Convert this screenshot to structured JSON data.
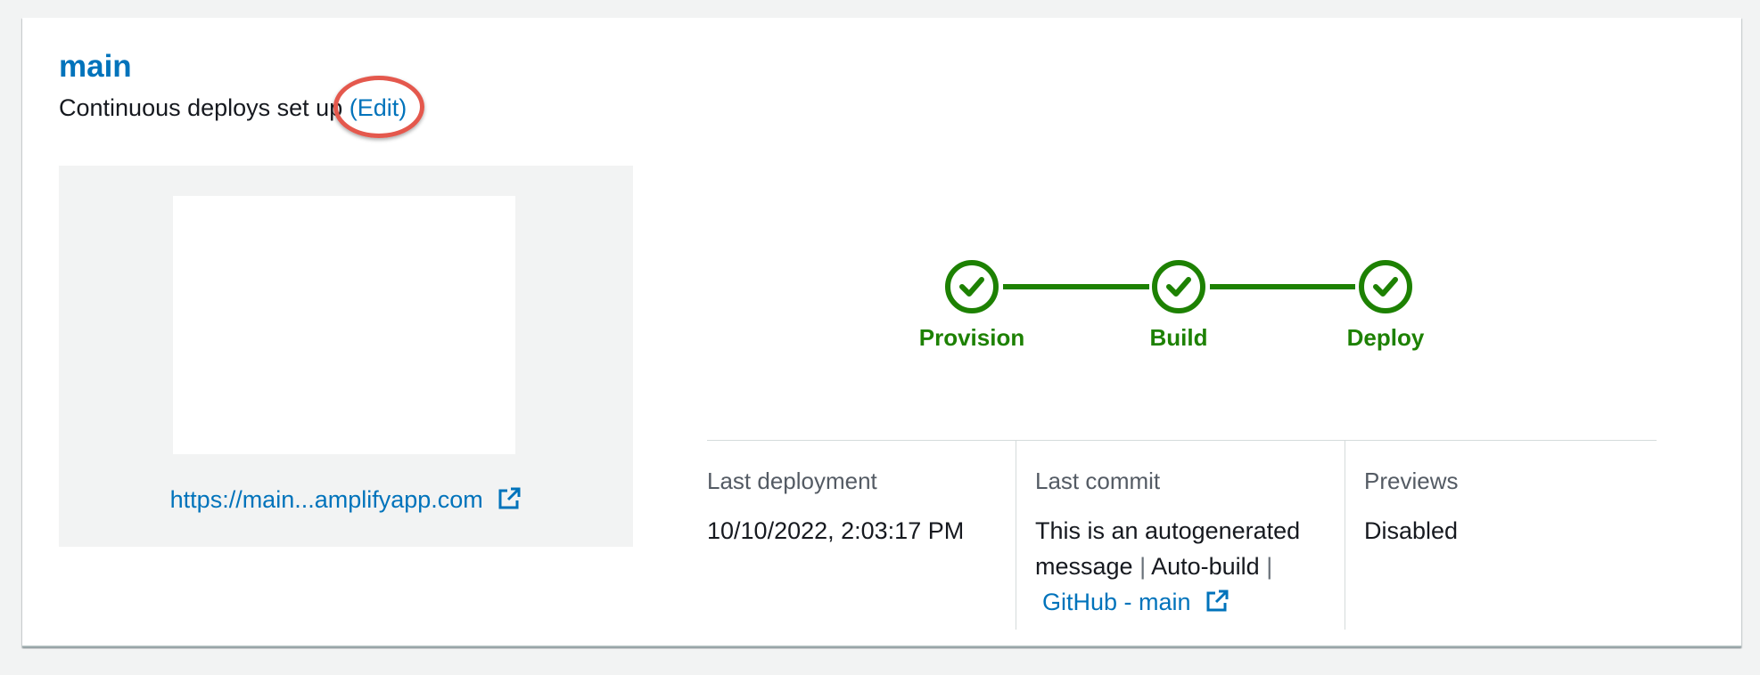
{
  "branch": {
    "name": "main",
    "subtitle": "Continuous deploys set up",
    "edit_label": "(Edit)"
  },
  "preview": {
    "url_label": "https://main...amplifyapp.com",
    "icon": "external-link-icon"
  },
  "pipeline": {
    "steps": [
      {
        "label": "Provision",
        "status": "succeeded",
        "icon": "check-icon"
      },
      {
        "label": "Build",
        "status": "succeeded",
        "icon": "check-icon"
      },
      {
        "label": "Deploy",
        "status": "succeeded",
        "icon": "check-icon"
      }
    ],
    "success_color": "#1d8102"
  },
  "stats": {
    "last_deployment": {
      "label": "Last deployment",
      "value": "10/10/2022, 2:03:17 PM"
    },
    "last_commit": {
      "label": "Last commit",
      "line1": "This is an autogenerated",
      "line2_text": "message",
      "separator": "|",
      "line2_build": "Auto-build",
      "link_label": "GitHub - main",
      "icon": "external-link-icon"
    },
    "previews": {
      "label": "Previews",
      "value": "Disabled"
    }
  },
  "colors": {
    "link": "#0073bb",
    "highlight": "#e4584d",
    "background": "#f2f3f3"
  }
}
